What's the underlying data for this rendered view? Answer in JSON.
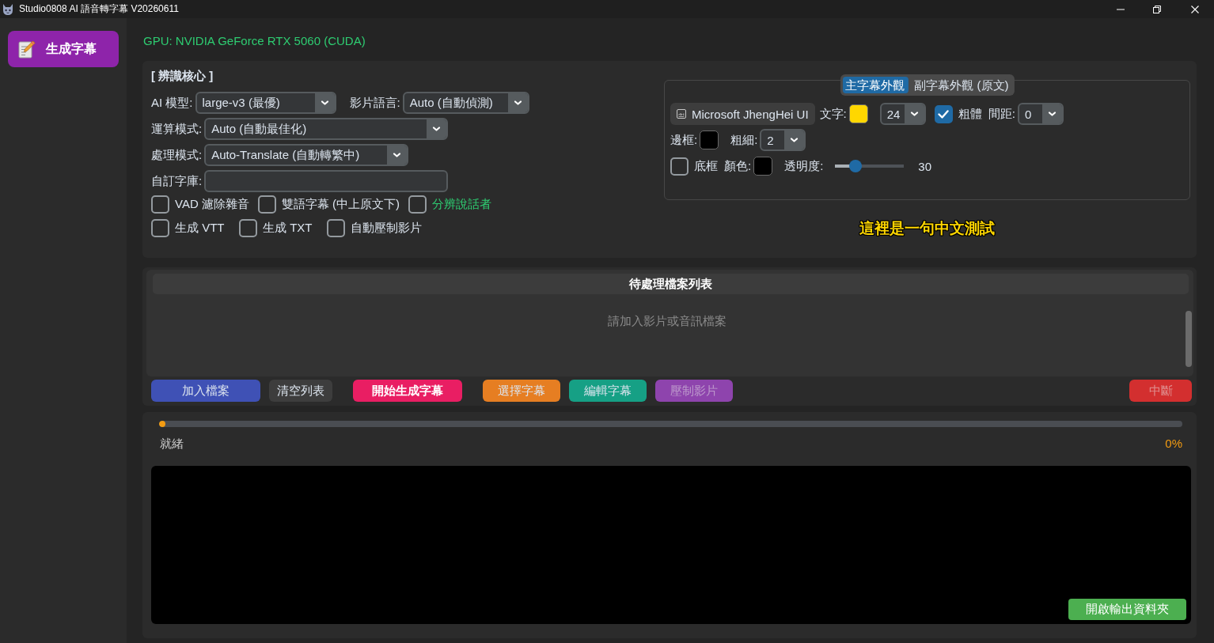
{
  "window": {
    "title": "Studio0808 AI 語音轉字幕 V20260611"
  },
  "sidebar": {
    "items": [
      {
        "label": "生成字幕",
        "selected": true
      }
    ]
  },
  "gpu_status": "GPU: NVIDIA GeForce RTX 5060 (CUDA)",
  "recognition": {
    "heading": "[ 辨識核心 ]",
    "rows": [
      {
        "fields": [
          {
            "label": "AI 模型:",
            "kind": "dropdown",
            "value": "large-v3 (最優)"
          },
          {
            "label": "影片語言:",
            "kind": "dropdown",
            "value": "Auto (自動偵測)"
          }
        ]
      },
      {
        "fields": [
          {
            "label": "運算模式:",
            "kind": "dropdown",
            "value": "Auto (自動最佳化)"
          }
        ]
      },
      {
        "fields": [
          {
            "label": "處理模式:",
            "kind": "dropdown",
            "value": "Auto-Translate (自動轉繁中)"
          }
        ]
      },
      {
        "fields": [
          {
            "label": "自訂字庫:",
            "kind": "text_input"
          }
        ]
      }
    ],
    "option_rows": [
      {
        "options": [
          {
            "label": "VAD 濾除雜音",
            "checked": false,
            "color": "#dce4ee"
          },
          {
            "label": "雙語字幕 (中上原文下)",
            "checked": false,
            "color": "#dce4ee"
          },
          {
            "label": "分辨說話者",
            "checked": false,
            "color": "#2ecc71"
          }
        ]
      },
      {
        "options": [
          {
            "label": "生成 VTT",
            "checked": false,
            "color": "#dce4ee"
          },
          {
            "label": "生成 TXT",
            "checked": false,
            "color": "#dce4ee"
          },
          {
            "label": "自動壓制影片",
            "checked": false,
            "color": "#dce4ee"
          }
        ]
      }
    ]
  },
  "subtitle_style": {
    "tabs": [
      {
        "label": "主字幕外觀",
        "selected": true
      },
      {
        "label": "副字幕外觀 (原文)",
        "selected": false
      }
    ],
    "rows": [
      {
        "items": [
          {
            "kind": "font_button",
            "text": "Microsoft JhengHei UI"
          },
          {
            "kind": "label",
            "text": "文字:"
          },
          {
            "kind": "swatch",
            "color": "#ffd700"
          },
          {
            "kind": "dropdown",
            "value": "24"
          },
          {
            "kind": "checkbox",
            "label": "粗體",
            "checked": true
          },
          {
            "kind": "label",
            "text": "間距:"
          },
          {
            "kind": "dropdown",
            "value": "0"
          }
        ]
      },
      {
        "items": [
          {
            "kind": "label",
            "text": "邊框:"
          },
          {
            "kind": "swatch",
            "color": "#000000"
          },
          {
            "kind": "label",
            "text": "粗細:"
          },
          {
            "kind": "dropdown",
            "value": "2"
          }
        ]
      },
      {
        "items": [
          {
            "kind": "checkbox",
            "label": "底框",
            "checked": false
          },
          {
            "kind": "label",
            "text": "顏色:"
          },
          {
            "kind": "swatch",
            "color": "#000000"
          },
          {
            "kind": "label",
            "text": "透明度:"
          },
          {
            "kind": "slider",
            "level": 0.3,
            "reading": "30"
          }
        ]
      }
    ],
    "preview_text": "這裡是一句中文測試"
  },
  "file_list": {
    "title": "待處理檔案列表",
    "empty_message": "請加入影片或音訊檔案"
  },
  "button_groups": [
    {
      "buttons": [
        {
          "label": "加入檔案",
          "kind": "normal",
          "color": "#3f51b5",
          "disabled": false
        },
        {
          "label": "清空列表",
          "kind": "normal",
          "color": "#3d3d3d",
          "disabled": false
        }
      ]
    },
    {
      "buttons": [
        {
          "label": "開始生成字幕",
          "kind": "primary",
          "color": "#e91e63",
          "disabled": false
        }
      ]
    },
    {
      "buttons": [
        {
          "label": "選擇字幕",
          "kind": "normal",
          "color": "#e67e22",
          "disabled": false
        },
        {
          "label": "編輯字幕",
          "kind": "normal",
          "color": "#16a085",
          "disabled": false
        },
        {
          "label": "壓制影片",
          "kind": "normal",
          "color": "#8e44ad",
          "disabled": true
        }
      ]
    }
  ],
  "stop_button": {
    "label": "中斷",
    "color": "#d32f2f",
    "disabled": true
  },
  "progress": {
    "level": 0,
    "status": "就緒",
    "percent": "0%"
  },
  "log": {
    "open_folder_button": "開啟輸出資料夾"
  }
}
